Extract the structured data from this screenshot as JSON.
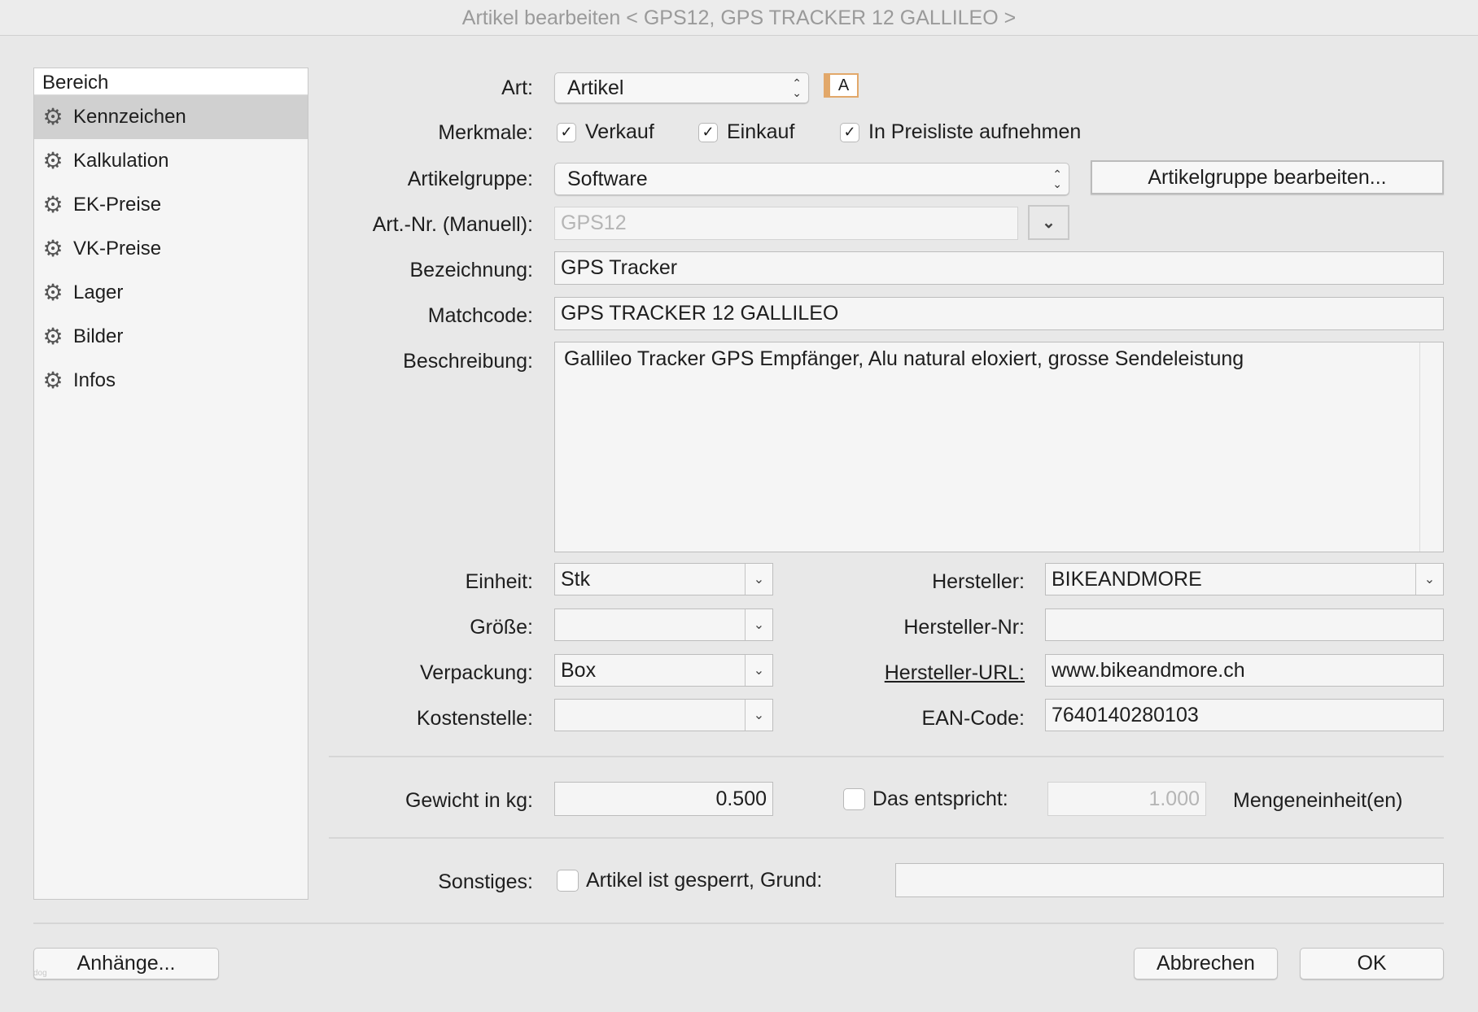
{
  "window": {
    "title": "Artikel bearbeiten < GPS12, GPS TRACKER 12 GALLILEO >"
  },
  "sidebar": {
    "header": "Bereich",
    "items": [
      {
        "label": "Kennzeichen",
        "selected": true
      },
      {
        "label": "Kalkulation"
      },
      {
        "label": "EK-Preise"
      },
      {
        "label": "VK-Preise"
      },
      {
        "label": "Lager"
      },
      {
        "label": "Bilder"
      },
      {
        "label": "Infos"
      }
    ]
  },
  "form": {
    "art": {
      "label": "Art:",
      "value": "Artikel",
      "badge": "A"
    },
    "merkmale": {
      "label": "Merkmale:",
      "options": [
        {
          "label": "Verkauf",
          "checked": true
        },
        {
          "label": "Einkauf",
          "checked": true
        },
        {
          "label": "In Preisliste aufnehmen",
          "checked": true
        }
      ]
    },
    "artikelgruppe": {
      "label": "Artikelgruppe:",
      "value": "Software",
      "button": "Artikelgruppe bearbeiten..."
    },
    "artnr": {
      "label": "Art.-Nr. (Manuell):",
      "value": "GPS12"
    },
    "bezeichnung": {
      "label": "Bezeichnung:",
      "value": "GPS Tracker"
    },
    "matchcode": {
      "label": "Matchcode:",
      "value": "GPS TRACKER 12 GALLILEO"
    },
    "beschreibung": {
      "label": "Beschreibung:",
      "value": "Gallileo Tracker GPS Empfänger, Alu natural eloxiert, grosse Sendeleistung"
    },
    "einheit": {
      "label": "Einheit:",
      "value": "Stk"
    },
    "groesse": {
      "label": "Größe:",
      "value": ""
    },
    "verpackung": {
      "label": "Verpackung:",
      "value": "Box"
    },
    "kostenstelle": {
      "label": "Kostenstelle:",
      "value": ""
    },
    "hersteller": {
      "label": "Hersteller:",
      "value": "BIKEANDMORE"
    },
    "herstellernr": {
      "label": "Hersteller-Nr:",
      "value": ""
    },
    "herstellerurl": {
      "label": "Hersteller-URL:",
      "value": "www.bikeandmore.ch"
    },
    "ean": {
      "label": "EAN-Code:",
      "value": "7640140280103"
    },
    "gewicht": {
      "label": "Gewicht in kg:",
      "value": "0.500"
    },
    "entspricht": {
      "label": "Das entspricht:",
      "checked": false,
      "value": "1.000",
      "unit": "Mengeneinheit(en)"
    },
    "sonstiges": {
      "label": "Sonstiges:",
      "checkbox": "Artikel ist gesperrt, Grund:",
      "checked": false,
      "value": ""
    }
  },
  "footer": {
    "attachments": "Anhänge...",
    "cancel": "Abbrechen",
    "ok": "OK",
    "tag": "dog"
  },
  "colors": {
    "badge": "#e2a86a",
    "selected": "#d0d0d0"
  }
}
